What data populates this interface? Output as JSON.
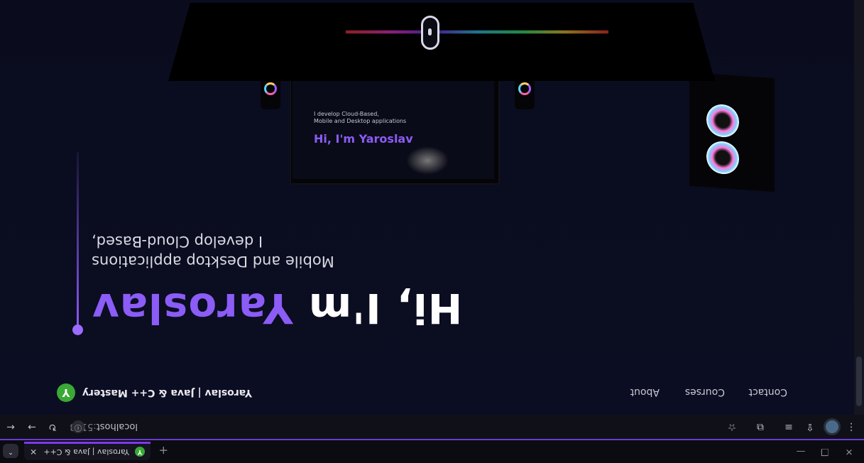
{
  "browser": {
    "tab_title": "Yaroslav | Java & C++ Mastery",
    "tab_close": "✕",
    "new_tab": "+",
    "tab_search": "⌃",
    "window_controls": {
      "minimize": "—",
      "maximize": "❐",
      "close": "✕"
    },
    "favicon_letter": "Y",
    "url_host": "localhost",
    "url_port": ":5173",
    "url_info": "ⓘ",
    "toolbar": {
      "back": "←",
      "forward": "→",
      "reload": "↻",
      "bookmark": "☆",
      "extensions": "⧉",
      "reading_list": "≡",
      "share": "⇪",
      "menu": "⋮"
    }
  },
  "site": {
    "brand_letter": "Y",
    "brand_name": "Yaroslav | Java & C++ Mastery",
    "nav": [
      "About",
      "Courses",
      "Contact"
    ]
  },
  "hero": {
    "heading_prefix": "Hi, I'm ",
    "heading_accent": "Yaroslav",
    "sub_line1": "I develop Cloud-Based,",
    "sub_line2": "Mobile and Desktop applications"
  },
  "mini_screen": {
    "heading_prefix": "Hi, I'm ",
    "heading_accent": "Yaroslav",
    "sub_line1": "I develop Cloud-Based,",
    "sub_line2": "Mobile and Desktop applications"
  },
  "colors": {
    "accent": "#8b5cf6",
    "brand_green": "#3aa935",
    "background": "#0a0c1f"
  }
}
